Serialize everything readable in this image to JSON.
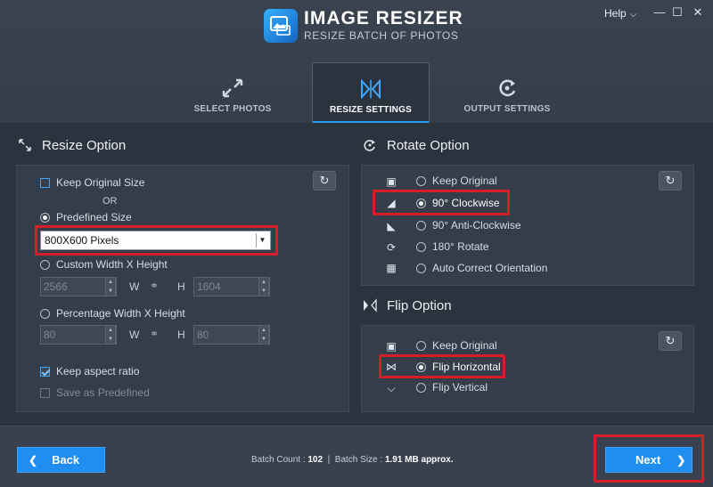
{
  "app": {
    "title": "IMAGE RESIZER",
    "subtitle": "RESIZE BATCH OF PHOTOS",
    "help_label": "Help",
    "window_controls": [
      "—",
      "☐",
      "✕"
    ]
  },
  "tabs": [
    {
      "label": "SELECT PHOTOS",
      "icon": "expand-arrows-icon",
      "active": false
    },
    {
      "label": "RESIZE SETTINGS",
      "icon": "resize-settings-icon",
      "active": true
    },
    {
      "label": "OUTPUT SETTINGS",
      "icon": "refresh-gear-icon",
      "active": false
    }
  ],
  "resize": {
    "title": "Resize Option",
    "keep_original_label": "Keep Original Size",
    "or_label": "OR",
    "predefined_label": "Predefined Size",
    "predefined_value": "800X600 Pixels",
    "custom_label": "Custom Width X Height",
    "custom_width": "2566",
    "custom_height": "1604",
    "percentage_label": "Percentage Width X Height",
    "pct_width": "80",
    "pct_height": "80",
    "w_label": "W",
    "h_label": "H",
    "keep_aspect_label": "Keep aspect ratio",
    "save_predefined_label": "Save as Predefined"
  },
  "rotate": {
    "title": "Rotate Option",
    "options": [
      {
        "label": "Keep Original",
        "selected": false
      },
      {
        "label": "90° Clockwise",
        "selected": true
      },
      {
        "label": "90° Anti-Clockwise",
        "selected": false
      },
      {
        "label": "180° Rotate",
        "selected": false
      },
      {
        "label": "Auto Correct Orientation",
        "selected": false
      }
    ]
  },
  "flip": {
    "title": "Flip Option",
    "options": [
      {
        "label": "Keep Original",
        "selected": false
      },
      {
        "label": "Flip Horizontal",
        "selected": true
      },
      {
        "label": "Flip Vertical",
        "selected": false
      }
    ]
  },
  "footer": {
    "back_label": "Back",
    "batch_count_label": "Batch Count :",
    "batch_count": "102",
    "separator": "|",
    "batch_size_label": "Batch Size :",
    "batch_size": "1.91 MB approx.",
    "next_label": "Next"
  },
  "colors": {
    "accent": "#1f8ef0",
    "highlight": "#d51e28",
    "background": "#2b333f"
  }
}
